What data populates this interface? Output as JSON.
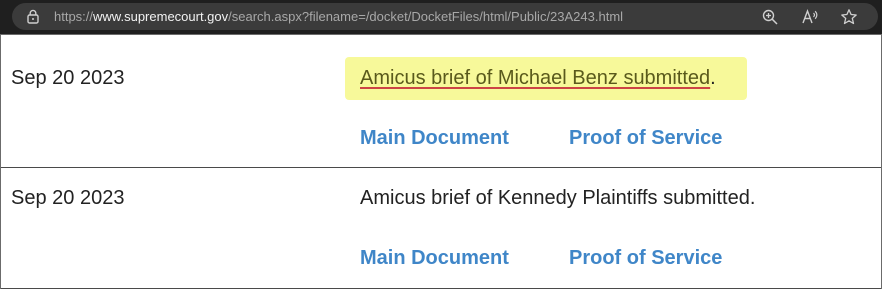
{
  "browser": {
    "url_prefix": "https://",
    "url_domain": "www.supremecourt.gov",
    "url_path": "/search.aspx?filename=/docket/DocketFiles/html/Public/23A243.html"
  },
  "docket": {
    "rows": [
      {
        "date": "Sep 20 2023",
        "description": "Amicus brief of Michael Benz submitted",
        "description_suffix": ".",
        "highlighted": true,
        "links": [
          "Main Document",
          "Proof of Service"
        ]
      },
      {
        "date": "Sep 20 2023",
        "description": "Amicus brief of Kennedy Plaintiffs submitted.",
        "description_suffix": "",
        "highlighted": false,
        "links": [
          "Main Document",
          "Proof of Service"
        ]
      }
    ]
  },
  "colors": {
    "link": "#3f86c8",
    "highlight": "#f7f99a",
    "address_bar": "#1f1f1f"
  },
  "icons": [
    "lock-icon",
    "zoom-icon",
    "read-aloud-icon",
    "favorite-star-icon"
  ]
}
